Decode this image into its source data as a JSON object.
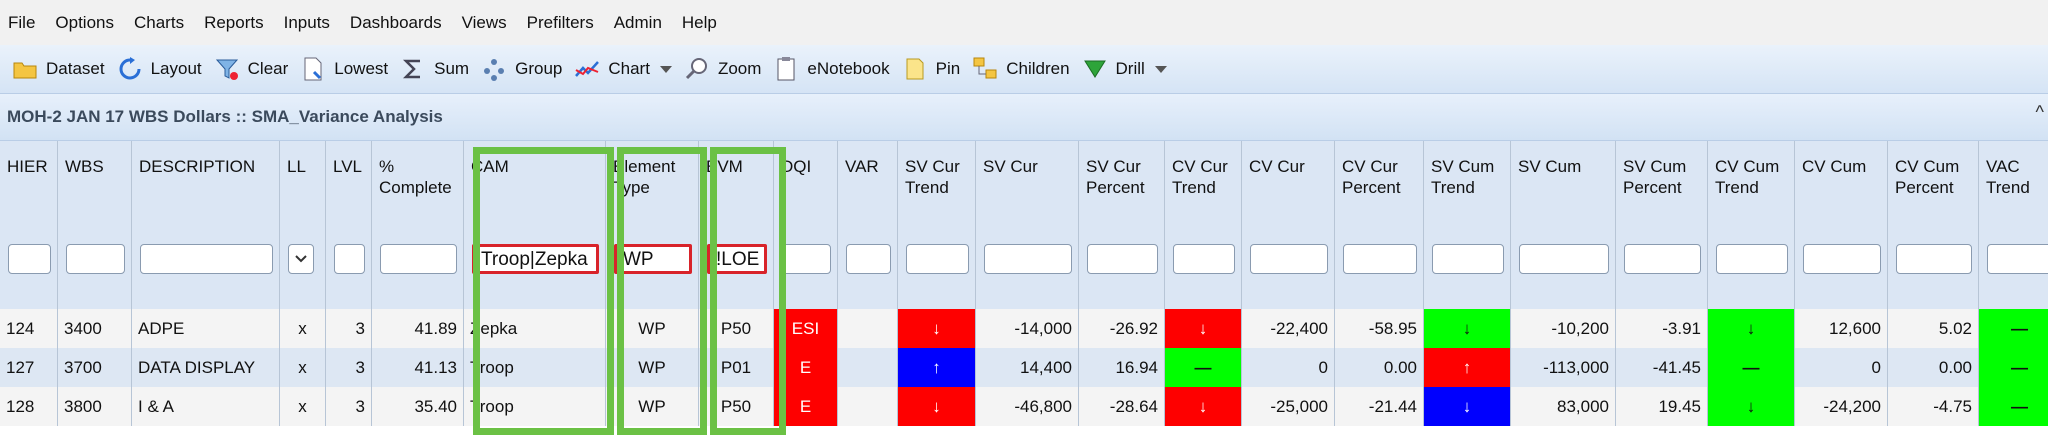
{
  "menubar": {
    "items": [
      "File",
      "Options",
      "Charts",
      "Reports",
      "Inputs",
      "Dashboards",
      "Views",
      "Prefilters",
      "Admin",
      "Help"
    ]
  },
  "toolbar": {
    "items": [
      {
        "label": "Dataset",
        "icon": "folder-icon"
      },
      {
        "label": "Layout",
        "icon": "refresh-icon"
      },
      {
        "label": "Clear",
        "icon": "funnel-icon"
      },
      {
        "label": "Lowest",
        "icon": "document-icon"
      },
      {
        "label": "Sum",
        "icon": "sigma-icon"
      },
      {
        "label": "Group",
        "icon": "group-icon"
      },
      {
        "label": "Chart",
        "icon": "chart-icon",
        "dropdown": true
      },
      {
        "label": "Zoom",
        "icon": "magnifier-icon"
      },
      {
        "label": "eNotebook",
        "icon": "notebook-icon"
      },
      {
        "label": "Pin",
        "icon": "pin-icon"
      },
      {
        "label": "Children",
        "icon": "children-icon"
      },
      {
        "label": "Drill",
        "icon": "drill-icon",
        "dropdown": true
      }
    ]
  },
  "panel": {
    "title": "MOH-2 JAN 17 WBS Dollars :: SMA_Variance Analysis",
    "collapse_icon": "^"
  },
  "columns": [
    {
      "key": "hier",
      "label": "HIER"
    },
    {
      "key": "wbs",
      "label": "WBS"
    },
    {
      "key": "desc",
      "label": "DESCRIPTION"
    },
    {
      "key": "ll",
      "label": "LL"
    },
    {
      "key": "lvl",
      "label": "LVL"
    },
    {
      "key": "pct",
      "label": "% Complete"
    },
    {
      "key": "cam",
      "label": "CAM"
    },
    {
      "key": "etype",
      "label": "Element Type"
    },
    {
      "key": "evm",
      "label": "EVM"
    },
    {
      "key": "dqi",
      "label": "DQI"
    },
    {
      "key": "var",
      "label": "VAR"
    },
    {
      "key": "svct",
      "label": "SV Cur Trend"
    },
    {
      "key": "svc",
      "label": "SV Cur"
    },
    {
      "key": "svcp",
      "label": "SV Cur Percent"
    },
    {
      "key": "cvct",
      "label": "CV Cur Trend"
    },
    {
      "key": "cvc",
      "label": "CV Cur"
    },
    {
      "key": "cvcp",
      "label": "CV Cur Percent"
    },
    {
      "key": "svmt",
      "label": "SV Cum Trend"
    },
    {
      "key": "svm",
      "label": "SV Cum"
    },
    {
      "key": "svmp",
      "label": "SV Cum Percent"
    },
    {
      "key": "cvmt",
      "label": "CV Cum Trend"
    },
    {
      "key": "cvm",
      "label": "CV Cum"
    },
    {
      "key": "cvmp",
      "label": "CV Cum Percent"
    },
    {
      "key": "vact",
      "label": "VAC Trend"
    }
  ],
  "filters": {
    "cam": "Troop|Zepka",
    "etype": "WP",
    "evm": "!LOE",
    "ll_dropdown": "v"
  },
  "rows": [
    {
      "hier": "124",
      "wbs": "3400",
      "desc": "ADPE",
      "ll": "x",
      "lvl": "3",
      "pct": "41.89",
      "cam": "Zepka",
      "etype": "WP",
      "evm": "P50",
      "dqi": "ESI",
      "var": "",
      "svct": "↓",
      "svc": "-14,000",
      "svcp": "-26.92",
      "cvct": "↓",
      "cvc": "-22,400",
      "cvcp": "-58.95",
      "svmt": "↓",
      "svm": "-10,200",
      "svmp": "-3.91",
      "cvmt": "↓",
      "cvm": "12,600",
      "cvmp": "5.02",
      "vact": "—"
    },
    {
      "hier": "127",
      "wbs": "3700",
      "desc": "DATA DISPLAY",
      "ll": "x",
      "lvl": "3",
      "pct": "41.13",
      "cam": "Troop",
      "etype": "WP",
      "evm": "P01",
      "dqi": "E",
      "var": "",
      "svct": "↑",
      "svc": "14,400",
      "svcp": "16.94",
      "cvct": "—",
      "cvc": "0",
      "cvcp": "0.00",
      "svmt": "↑",
      "svm": "-113,000",
      "svmp": "-41.45",
      "cvmt": "—",
      "cvm": "0",
      "cvmp": "0.00",
      "vact": "—"
    },
    {
      "hier": "128",
      "wbs": "3800",
      "desc": "I & A",
      "ll": "x",
      "lvl": "3",
      "pct": "35.40",
      "cam": "Troop",
      "etype": "WP",
      "evm": "P50",
      "dqi": "E",
      "var": "",
      "svct": "↓",
      "svc": "-46,800",
      "svcp": "-28.64",
      "cvct": "↓",
      "cvc": "-25,000",
      "cvcp": "-21.44",
      "svmt": "↓",
      "svm": "83,000",
      "svmp": "19.45",
      "cvmt": "↓",
      "cvm": "-24,200",
      "cvmp": "-4.75",
      "vact": "—"
    }
  ],
  "cell_colors": {
    "dqi": [
      "#fe0000",
      "#fe0000",
      "#fe0000"
    ],
    "svct": [
      "#fe0000",
      "#0000fe",
      "#fe0000"
    ],
    "cvct": [
      "#fe0000",
      "#00ff00",
      "#fe0000"
    ],
    "svmt": [
      "#00ff00",
      "#fe0000",
      "#0000fe"
    ],
    "cvmt": [
      "#00ff00",
      "#00ff00",
      "#00ff00"
    ],
    "vact": [
      "#00ff00",
      "#00ff00",
      "#00ff00"
    ]
  },
  "highlight_color": "#6bc145",
  "filter_highlight_color": "#d8232a"
}
